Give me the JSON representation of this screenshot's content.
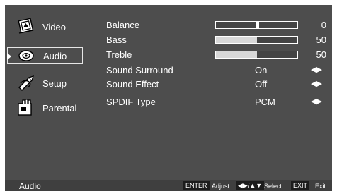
{
  "nav": {
    "items": [
      {
        "label": "Video",
        "icon": "video-icon",
        "selected": false
      },
      {
        "label": "Audio",
        "icon": "audio-icon",
        "selected": true
      },
      {
        "label": "Setup",
        "icon": "setup-icon",
        "selected": false
      },
      {
        "label": "Parental",
        "icon": "parental-icon",
        "selected": false
      }
    ]
  },
  "settings": {
    "balance": {
      "label": "Balance",
      "value": "0",
      "level": 0.5
    },
    "bass": {
      "label": "Bass",
      "value": "50",
      "level": 0.5
    },
    "treble": {
      "label": "Treble",
      "value": "50",
      "level": 0.5
    },
    "sound_surround": {
      "label": "Sound Surround",
      "value": "On",
      "arrows": "◀▶"
    },
    "sound_effect": {
      "label": "Sound Effect",
      "value": "Off",
      "arrows": "◀▶"
    },
    "spdif_type": {
      "label": "SPDIF Type",
      "value": "PCM",
      "arrows": "◀▶"
    }
  },
  "statusbar": {
    "title": "Audio",
    "enter_key": "ENTER",
    "adjust_label": "Adjust",
    "arrows_key": "◀▶/▲▼",
    "select_label": "Select",
    "exit_key": "EXIT",
    "exit_label": "Exit"
  },
  "colors": {
    "background": "#4d4d4d",
    "slider_fill": "#d8d8d8",
    "key_background": "#1c1c1c"
  }
}
